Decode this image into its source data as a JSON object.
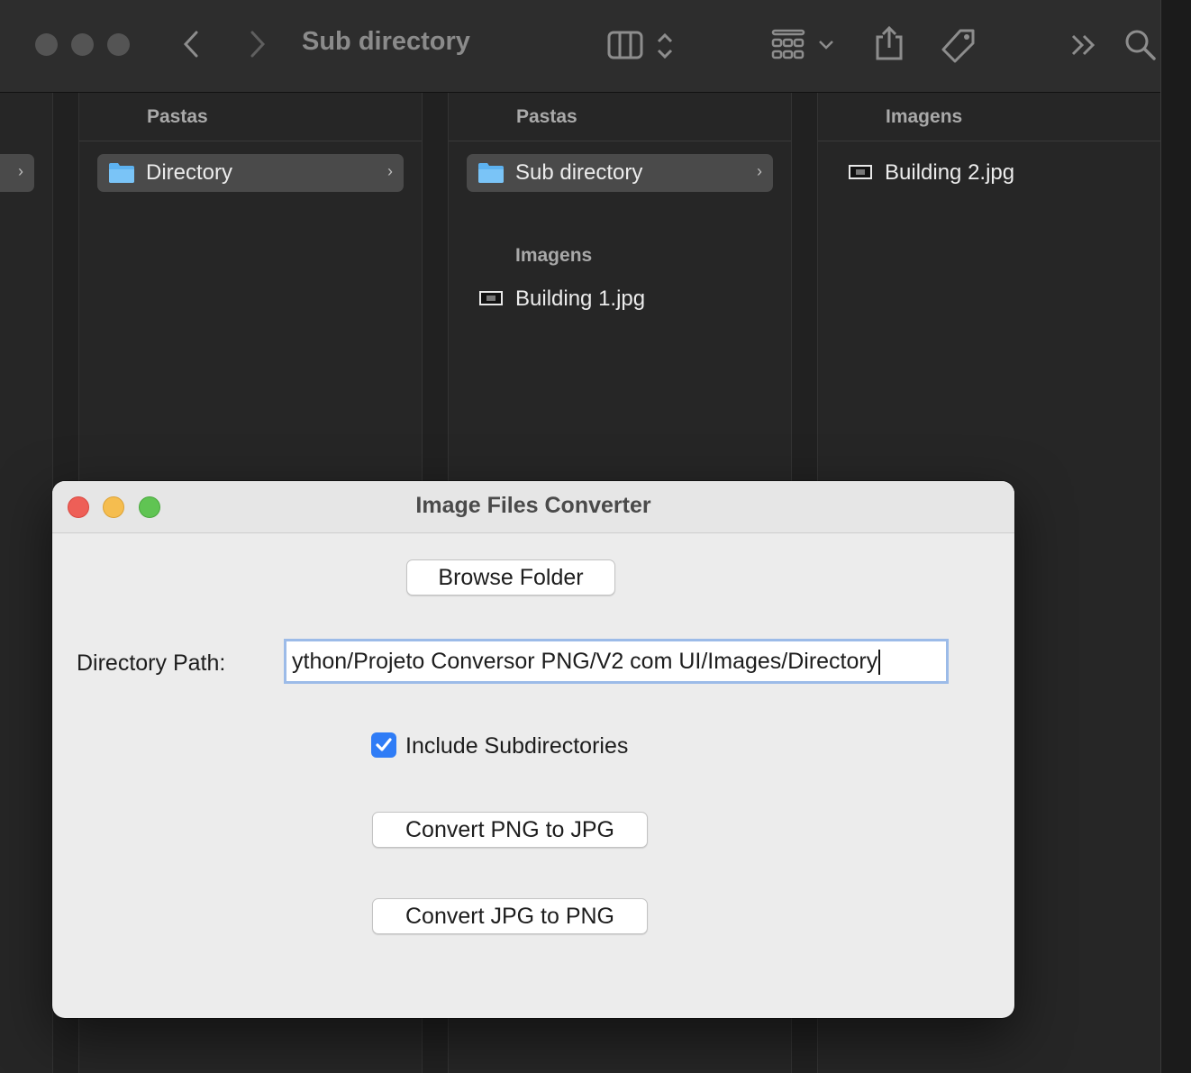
{
  "finder": {
    "title": "Sub directory",
    "columns": [
      {
        "header": "Pastas",
        "items": [
          {
            "label": "Directory",
            "type": "folder",
            "selected": true
          }
        ]
      },
      {
        "header": "Pastas",
        "items": [
          {
            "label": "Sub directory",
            "type": "folder",
            "selected": true
          }
        ],
        "section": {
          "header": "Imagens",
          "items": [
            {
              "label": "Building 1.jpg",
              "type": "image"
            }
          ]
        }
      },
      {
        "header": "Imagens",
        "items": [
          {
            "label": "Building 2.jpg",
            "type": "image"
          }
        ]
      }
    ],
    "toolbar_icons": [
      "back-icon",
      "forward-icon",
      "column-view-icon",
      "group-icon",
      "share-icon",
      "tag-icon",
      "more-icon",
      "search-icon"
    ]
  },
  "dialog": {
    "title": "Image Files Converter",
    "browse_label": "Browse Folder",
    "directory_label": "Directory Path:",
    "directory_value": "ython/Projeto Conversor PNG/V2 com UI/Images/Directory",
    "include_subdirs_label": "Include Subdirectories",
    "include_subdirs_checked": true,
    "convert_png_label": "Convert PNG to JPG",
    "convert_jpg_label": "Convert JPG to PNG"
  },
  "colors": {
    "close": "#ee5f57",
    "minimize": "#f5bd4f",
    "zoom": "#60c453",
    "checkbox": "#2f7cf6",
    "input_focus": "#9cbbe8"
  }
}
